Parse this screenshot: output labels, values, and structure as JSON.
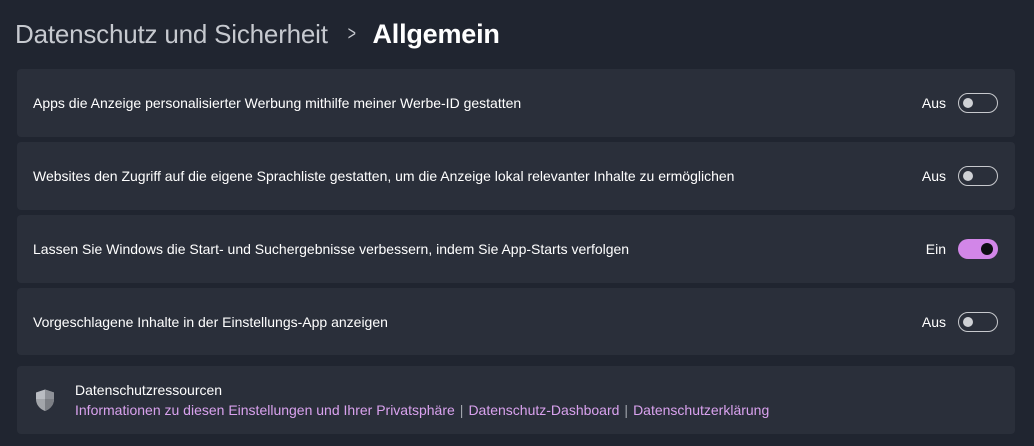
{
  "breadcrumb": {
    "parent": "Datenschutz und Sicherheit",
    "separator": ">",
    "current": "Allgemein"
  },
  "settings": [
    {
      "label": "Apps die Anzeige personalisierter Werbung mithilfe meiner Werbe-ID gestatten",
      "state_label": "Aus",
      "enabled": false
    },
    {
      "label": "Websites den Zugriff auf die eigene Sprachliste gestatten, um die Anzeige lokal relevanter Inhalte zu ermöglichen",
      "state_label": "Aus",
      "enabled": false
    },
    {
      "label": "Lassen Sie Windows die Start- und Suchergebnisse verbessern, indem Sie App-Starts verfolgen",
      "state_label": "Ein",
      "enabled": true
    },
    {
      "label": "Vorgeschlagene Inhalte in der Einstellungs-App anzeigen",
      "state_label": "Aus",
      "enabled": false
    }
  ],
  "resources": {
    "icon": "shield-icon",
    "title": "Datenschutzressourcen",
    "links": [
      "Informationen zu diesen Einstellungen und Ihrer Privatsphäre",
      "Datenschutz-Dashboard",
      "Datenschutzerklärung"
    ],
    "separator": "|"
  },
  "colors": {
    "background": "#202530",
    "card": "#2a2f3a",
    "accent": "#d286e8",
    "link": "#d9a2ee"
  }
}
